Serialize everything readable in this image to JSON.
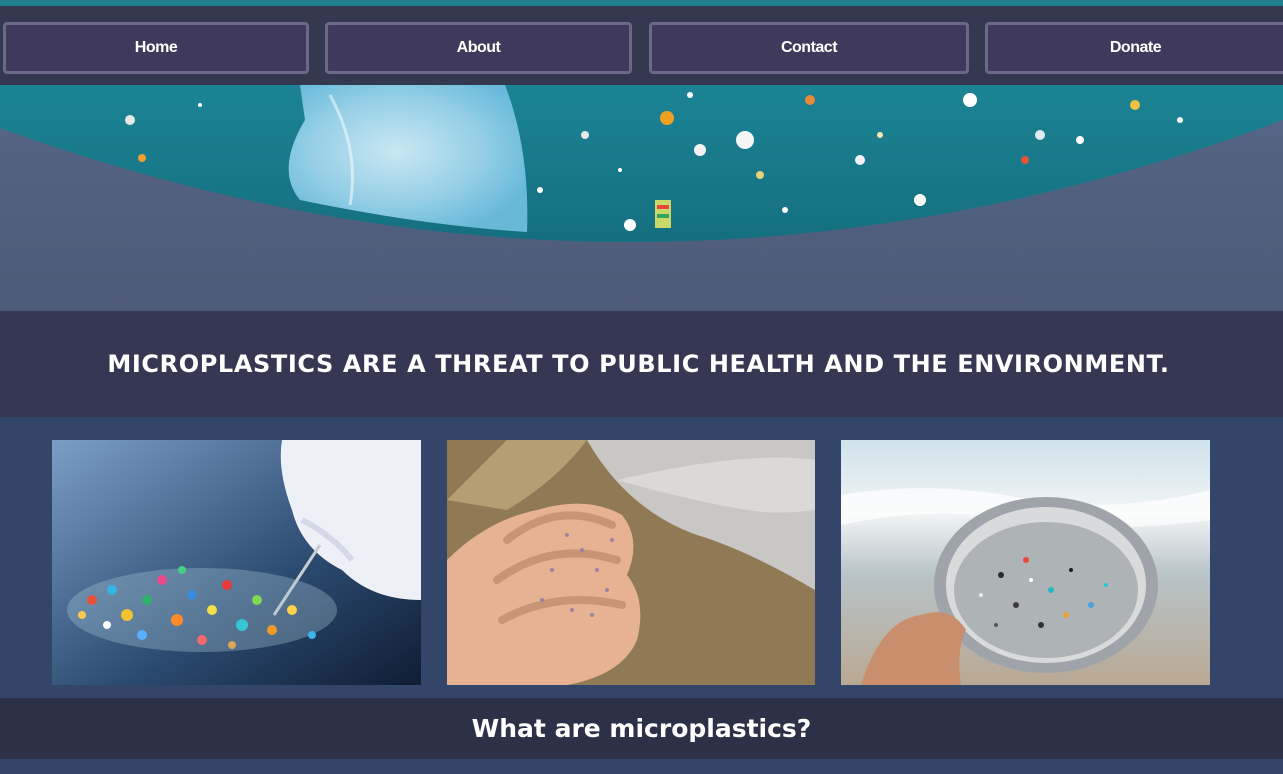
{
  "nav": {
    "items": [
      {
        "label": "Home"
      },
      {
        "label": "About"
      },
      {
        "label": "Contact"
      },
      {
        "label": "Donate"
      }
    ]
  },
  "headline": "MICROPLASTICS ARE A THREAT TO PUBLIC HEALTH AND THE ENVIRONMENT.",
  "photos": [
    {
      "name": "microplastic-pieces-tweezers-photo"
    },
    {
      "name": "sand-hand-microplastics-photo"
    },
    {
      "name": "beach-sieve-microplastics-photo"
    }
  ],
  "section_heading": "What are microplastics?",
  "colors": {
    "nav_bg": "#34394f",
    "nav_button_bg": "#3f3a5c",
    "nav_button_border": "#6b6888",
    "headline_band": "#363853",
    "photo_strip": "#33466a",
    "question_band": "#2d3148",
    "ocean": "#1b8898"
  }
}
